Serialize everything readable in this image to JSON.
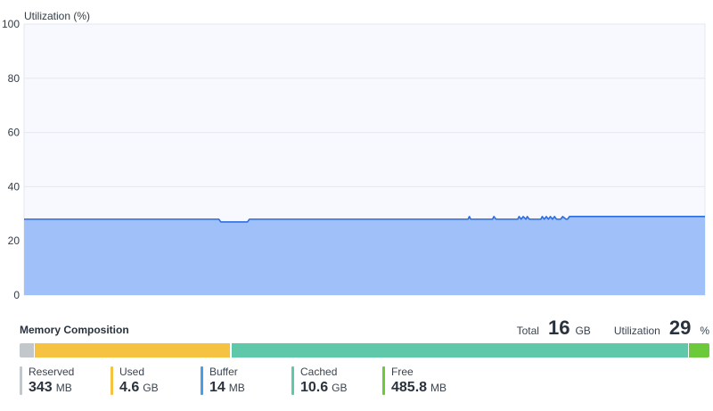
{
  "chart": {
    "y_title": "Utilization (%)"
  },
  "chart_data": {
    "type": "area",
    "title": "",
    "xlabel": "",
    "ylabel": "Utilization (%)",
    "ylim": [
      0,
      100
    ],
    "yticks": [
      0,
      20,
      40,
      60,
      80,
      100
    ],
    "grid": true,
    "legend": "none",
    "series": [
      {
        "name": "",
        "color": "#2d6ee0",
        "fill": "#a0c0fa",
        "x": [
          0,
          28.6,
          28.9,
          32.8,
          33.1,
          65.2,
          65.4,
          65.6,
          68.8,
          69.0,
          69.3,
          72.5,
          72.7,
          73.0,
          73.3,
          73.7,
          73.9,
          74.2,
          75.9,
          76.1,
          76.4,
          76.7,
          77.0,
          77.3,
          77.6,
          77.9,
          78.2,
          78.8,
          79.1,
          79.6,
          79.8,
          80.1,
          100
        ],
        "y": [
          28,
          28,
          27,
          27,
          28,
          28,
          29,
          28,
          28,
          29,
          28,
          28,
          29,
          28,
          29,
          28,
          29,
          28,
          28,
          29,
          28,
          29,
          28,
          29,
          28,
          29,
          28,
          28,
          29,
          28,
          28,
          29,
          29
        ]
      }
    ]
  },
  "composition": {
    "title": "Memory Composition",
    "total_label": "Total",
    "total_value": "16",
    "total_unit": "GB",
    "util_label": "Utilization",
    "util_value": "29",
    "util_unit": "%",
    "segments": [
      {
        "name": "Reserved",
        "color": "#c2c7cc",
        "fraction": 0.0214
      },
      {
        "name": "Used",
        "color": "#f5c242",
        "fraction": 0.2846
      },
      {
        "name": "Buffer",
        "color": "#4a9ee6",
        "fraction": 0.0009
      },
      {
        "name": "Cached",
        "color": "#5ec8a8",
        "fraction": 0.6628
      },
      {
        "name": "Free",
        "color": "#6cc93a",
        "fraction": 0.0303
      }
    ],
    "legend": [
      {
        "label": "Reserved",
        "value": "343",
        "unit": "MB",
        "color": "#c2c7cc"
      },
      {
        "label": "Used",
        "value": "4.6",
        "unit": "GB",
        "color": "#f5c242"
      },
      {
        "label": "Buffer",
        "value": "14",
        "unit": "MB",
        "color": "#4a9ee6"
      },
      {
        "label": "Cached",
        "value": "10.6",
        "unit": "GB",
        "color": "#5ec8a8"
      },
      {
        "label": "Free",
        "value": "485.8",
        "unit": "MB",
        "color": "#6cc93a"
      }
    ]
  }
}
